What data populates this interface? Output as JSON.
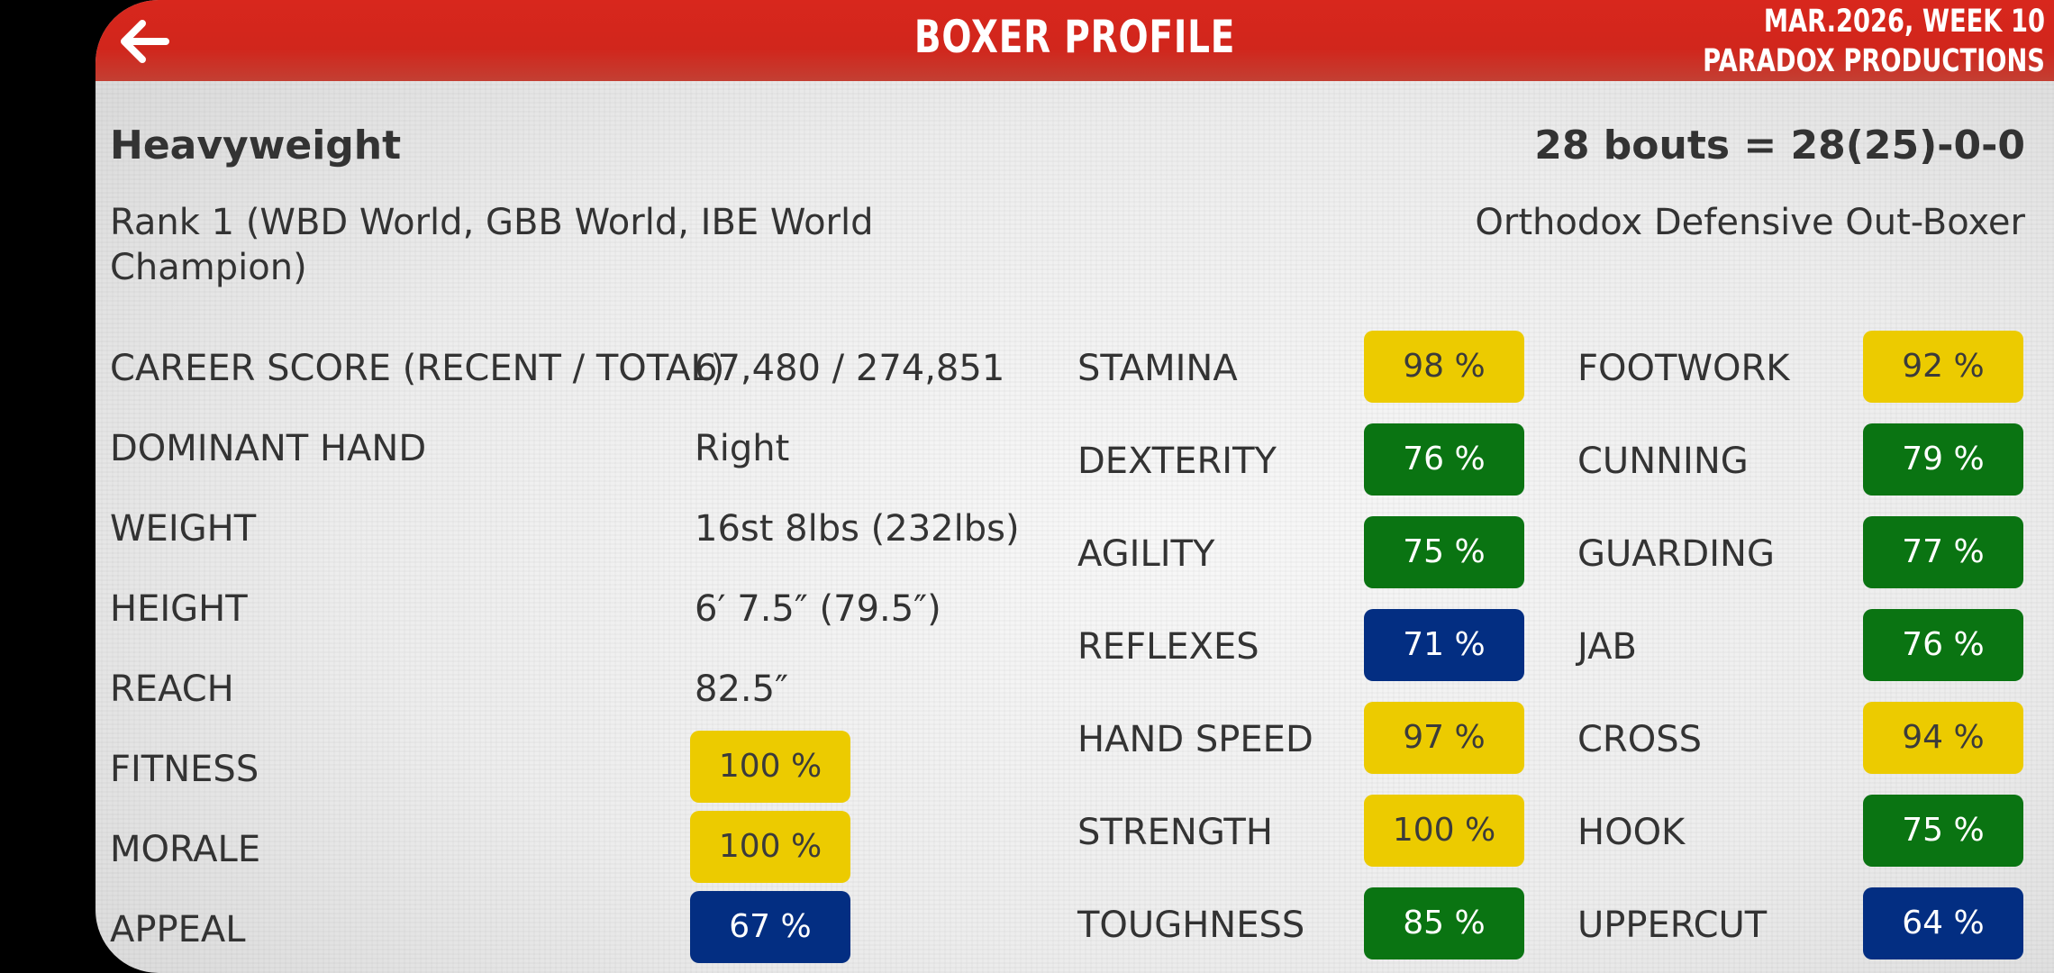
{
  "header": {
    "title": "BOXER PROFILE",
    "date_line": "MAR.2026, WEEK 10",
    "studio_line": "PARADOX PRODUCTIONS"
  },
  "profile": {
    "weight_class": "Heavyweight",
    "record": "28 bouts = 28(25)-0-0",
    "rank_line1": "Rank 1 (WBD World, GBB World, IBE World",
    "rank_line2": "Champion)",
    "style": "Orthodox Defensive Out-Boxer"
  },
  "details": [
    {
      "label": "CAREER SCORE (RECENT / TOTAL)",
      "value": "67,480 / 274,851"
    },
    {
      "label": "DOMINANT HAND",
      "value": "Right"
    },
    {
      "label": "WEIGHT",
      "value": "16st 8lbs (232lbs)"
    },
    {
      "label": "HEIGHT",
      "value": "6′ 7.5″ (79.5″)"
    },
    {
      "label": "REACH",
      "value": "82.5″"
    }
  ],
  "conditions": [
    {
      "label": "FITNESS",
      "value": "100 %",
      "level": 100,
      "color": "#eccb00"
    },
    {
      "label": "MORALE",
      "value": "100 %",
      "level": 100,
      "color": "#eccb00"
    },
    {
      "label": "APPEAL",
      "value": "67 %",
      "level": 67,
      "color": "#032e82"
    }
  ],
  "attributes_left": [
    {
      "label": "STAMINA",
      "value": "98 %",
      "level": 98,
      "color": "#eccb00"
    },
    {
      "label": "DEXTERITY",
      "value": "76 %",
      "level": 76,
      "color": "#0a7412"
    },
    {
      "label": "AGILITY",
      "value": "75 %",
      "level": 75,
      "color": "#0a7412"
    },
    {
      "label": "REFLEXES",
      "value": "71 %",
      "level": 71,
      "color": "#032e82"
    },
    {
      "label": "HAND SPEED",
      "value": "97 %",
      "level": 97,
      "color": "#eccb00"
    },
    {
      "label": "STRENGTH",
      "value": "100 %",
      "level": 100,
      "color": "#eccb00"
    },
    {
      "label": "TOUGHNESS",
      "value": "85 %",
      "level": 85,
      "color": "#0a7412"
    }
  ],
  "attributes_right": [
    {
      "label": "FOOTWORK",
      "value": "92 %",
      "level": 92,
      "color": "#eccb00"
    },
    {
      "label": "CUNNING",
      "value": "79 %",
      "level": 79,
      "color": "#0a7412"
    },
    {
      "label": "GUARDING",
      "value": "77 %",
      "level": 77,
      "color": "#0a7412"
    },
    {
      "label": "JAB",
      "value": "76 %",
      "level": 76,
      "color": "#0a7412"
    },
    {
      "label": "CROSS",
      "value": "94 %",
      "level": 94,
      "color": "#eccb00"
    },
    {
      "label": "HOOK",
      "value": "75 %",
      "level": 75,
      "color": "#0a7412"
    },
    {
      "label": "UPPERCUT",
      "value": "64 %",
      "level": 64,
      "color": "#032e82"
    }
  ],
  "icons": {
    "back": "back-arrow-icon"
  },
  "colors": {
    "header": "#d1261c",
    "high": "#eccb00",
    "good": "#0a7412",
    "average": "#032e82"
  }
}
